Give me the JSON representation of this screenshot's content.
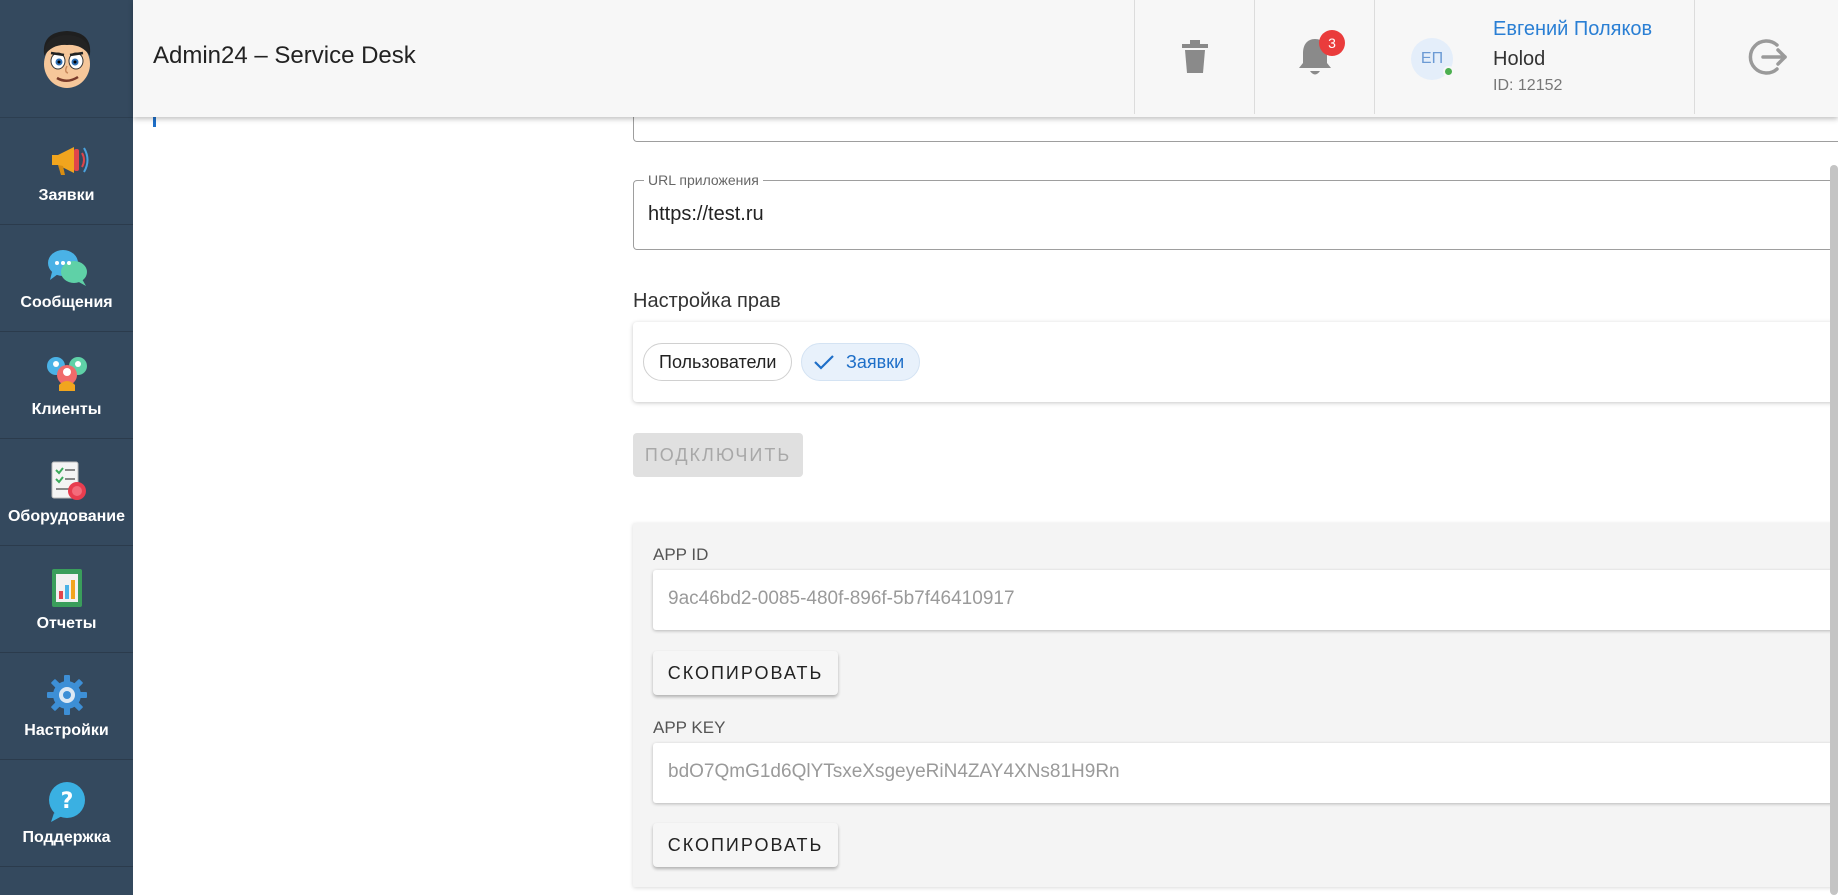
{
  "header": {
    "title": "Admin24 – Service Desk",
    "notifications_count": "3",
    "user": {
      "initials": "ЕП",
      "name": "Евгений Поляков",
      "org": "Holod",
      "id": "ID: 12152"
    }
  },
  "sidebar": {
    "items": [
      {
        "label": "Заявки",
        "icon": "megaphone-icon"
      },
      {
        "label": "Сообщения",
        "icon": "chat-bubbles-icon"
      },
      {
        "label": "Клиенты",
        "icon": "clients-icon"
      },
      {
        "label": "Оборудование",
        "icon": "equipment-checklist-icon"
      },
      {
        "label": "Отчеты",
        "icon": "reports-icon"
      },
      {
        "label": "Настройки",
        "icon": "gear-icon"
      },
      {
        "label": "Поддержка",
        "icon": "help-icon"
      }
    ]
  },
  "form": {
    "url_label": "URL приложения",
    "url_value": "https://test.ru",
    "rights_title": "Настройка прав",
    "chips": [
      {
        "label": "Пользователи",
        "selected": false
      },
      {
        "label": "Заявки",
        "selected": true
      }
    ],
    "connect_label": "ПОДКЛЮЧИТЬ"
  },
  "keys": {
    "app_id_label": "APP ID",
    "app_id_value": "9ac46bd2-0085-480f-896f-5b7f46410917",
    "app_key_label": "APP KEY",
    "app_key_value": "bdO7QmG1d6QlYTsxeXsgeyeRiN4ZAY4XNs81H9Rn",
    "copy_label": "СКОПИРОВАТЬ"
  },
  "colors": {
    "sidebar_bg": "#34495e",
    "accent": "#1e6fc8",
    "badge": "#ea3c3c",
    "online": "#4caf50"
  }
}
